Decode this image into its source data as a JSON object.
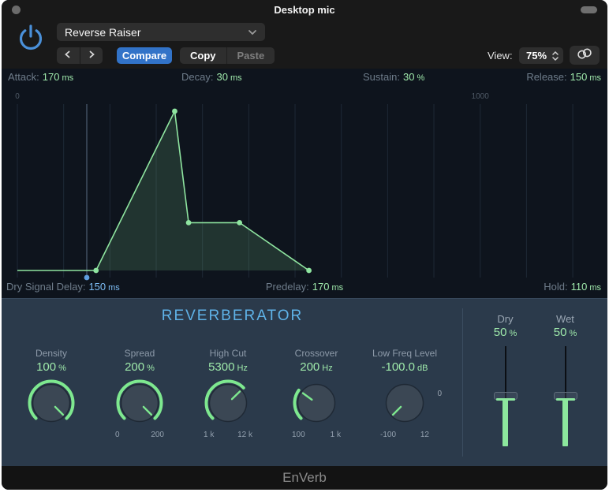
{
  "window": {
    "title": "Desktop mic"
  },
  "header": {
    "preset": "Reverse Raiser",
    "compare_label": "Compare",
    "copy_label": "Copy",
    "paste_label": "Paste",
    "view_label": "View:",
    "zoom_value": "75%"
  },
  "icons": {
    "power": "power-icon",
    "preset_chevron": "chevron-down-icon",
    "prev": "chevron-left-icon",
    "next": "chevron-right-icon",
    "zoom_stepper": "stepper-up-down-icon",
    "link": "link-icon"
  },
  "envelope": {
    "params_top": [
      {
        "label": "Attack:",
        "value": "170",
        "unit": "ms"
      },
      {
        "label": "Decay:",
        "value": "30",
        "unit": "ms"
      },
      {
        "label": "Sustain:",
        "value": "30",
        "unit": "%"
      },
      {
        "label": "Release:",
        "value": "150",
        "unit": "ms"
      }
    ],
    "params_bottom": [
      {
        "label": "Dry Signal Delay:",
        "value": "150",
        "unit": "ms",
        "color": "blue"
      },
      {
        "label": "Predelay:",
        "value": "170",
        "unit": "ms",
        "color": "green"
      },
      {
        "label": "Hold:",
        "value": "110",
        "unit": "ms",
        "color": "green"
      }
    ],
    "ruler": {
      "start": "0",
      "mid": "1000"
    },
    "values_ms": {
      "dry_signal_delay": 150,
      "predelay": 170,
      "attack": 170,
      "decay": 30,
      "sustain_pct": 30,
      "hold": 110,
      "release": 150
    },
    "colors": {
      "line": "#8fe5a0",
      "fill": "rgba(134,226,150,0.16)",
      "grid": "#1e2936",
      "delay_marker": "#5a6d85",
      "blue_dot": "#5f9fe0",
      "ruler_text": "#4f5a66"
    }
  },
  "reverberator": {
    "title": "REVERBERATOR",
    "knobs": [
      {
        "label": "Density",
        "value": "100",
        "unit": "%",
        "fraction": 1.0,
        "scale": [
          "",
          ""
        ]
      },
      {
        "label": "Spread",
        "value": "200",
        "unit": "%",
        "fraction": 1.0,
        "scale": [
          "0",
          "200"
        ]
      },
      {
        "label": "High Cut",
        "value": "5300",
        "unit": "Hz",
        "fraction": 0.67,
        "scale": [
          "1 k",
          "12 k"
        ]
      },
      {
        "label": "Crossover",
        "value": "200",
        "unit": "Hz",
        "fraction": 0.3,
        "scale": [
          "100",
          "1 k"
        ]
      },
      {
        "label": "Low Freq Level",
        "value": "-100.0",
        "unit": "dB",
        "fraction": 0.0,
        "scale": [
          "-100",
          "12"
        ],
        "side_label": "0"
      }
    ],
    "knob_colors": {
      "arc": "#7ee88f",
      "body": "#3b4754",
      "body_edge": "#1f2935"
    },
    "sliders": [
      {
        "label": "Dry",
        "value": "50",
        "unit": "%",
        "fraction": 0.5
      },
      {
        "label": "Wet",
        "value": "50",
        "unit": "%",
        "fraction": 0.5
      }
    ]
  },
  "footer": {
    "brand": "EnVerb"
  }
}
